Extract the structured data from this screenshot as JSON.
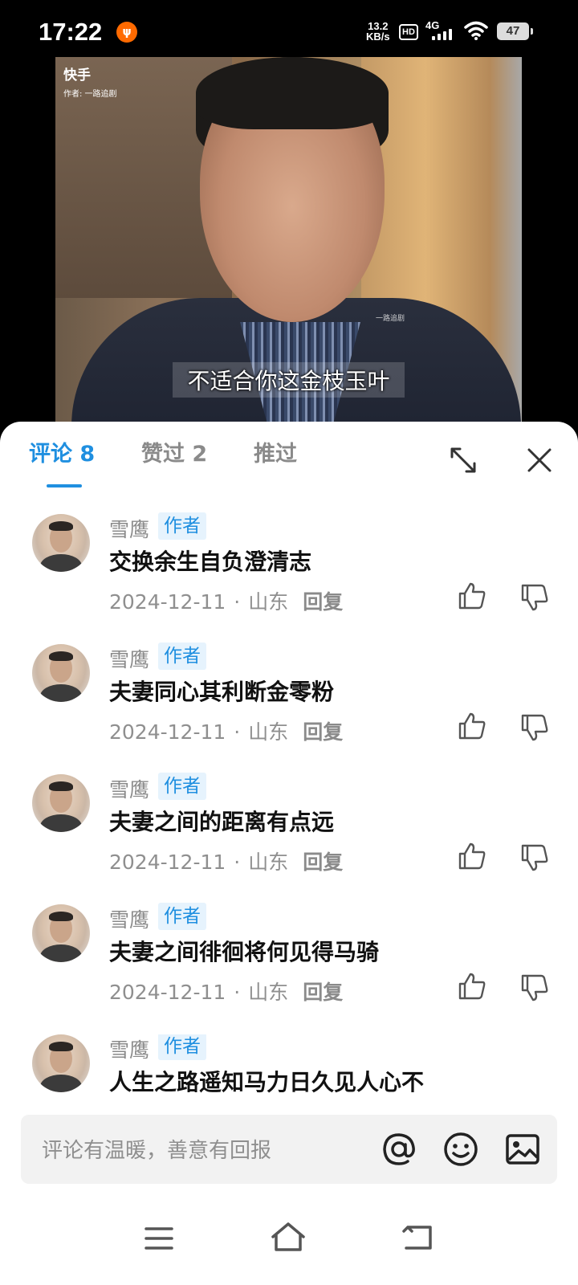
{
  "status_bar": {
    "time": "17:22",
    "speed_value": "13.2",
    "speed_unit": "KB/s",
    "hd": "HD",
    "network": "4G",
    "battery": "47"
  },
  "video": {
    "app_logo": "快手",
    "author_line": "作者: 一路追剧",
    "watermark": "一路追剧",
    "subtitle": "不适合你这金枝玉叶"
  },
  "tabs": [
    {
      "label": "评论 8",
      "active": true
    },
    {
      "label": "赞过 2",
      "active": false
    },
    {
      "label": "推过",
      "active": false
    }
  ],
  "comments": [
    {
      "user": "雪鹰",
      "badge": "作者",
      "text": "交换余生自负澄清志",
      "date": "2024-12-11",
      "location": "山东",
      "reply": "回复"
    },
    {
      "user": "雪鹰",
      "badge": "作者",
      "text": "夫妻同心其利断金零粉",
      "date": "2024-12-11",
      "location": "山东",
      "reply": "回复"
    },
    {
      "user": "雪鹰",
      "badge": "作者",
      "text": "夫妻之间的距离有点远",
      "date": "2024-12-11",
      "location": "山东",
      "reply": "回复"
    },
    {
      "user": "雪鹰",
      "badge": "作者",
      "text": "夫妻之间徘徊将何见得马骑",
      "date": "2024-12-11",
      "location": "山东",
      "reply": "回复"
    },
    {
      "user": "雪鹰",
      "badge": "作者",
      "text": "人生之路遥知马力日久见人心不",
      "date": "",
      "location": "",
      "reply": ""
    }
  ],
  "input": {
    "placeholder": "评论有温暖，善意有回报"
  },
  "colors": {
    "accent": "#1f8fe0",
    "badge_bg": "#e6f3fd"
  }
}
